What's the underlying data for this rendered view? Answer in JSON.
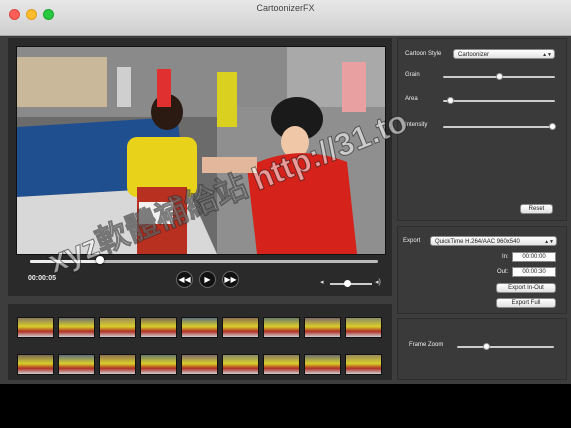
{
  "window": {
    "title": "CartoonizerFX"
  },
  "player": {
    "time": "00:00:05",
    "scrub_fraction": 0.2,
    "volume_fraction": 0.4
  },
  "controls": {
    "cartoon_style_label": "Cartoon Style",
    "cartoon_style_value": "Cartoonizer",
    "grain_label": "Grain",
    "grain_value": 0.5,
    "area_label": "Area",
    "area_value": 0.06,
    "intensity_label": "Intensity",
    "intensity_value": 0.97,
    "reset_label": "Reset"
  },
  "export": {
    "label": "Export",
    "format_value": "QuickTime H.264/AAC 960x540",
    "in_label": "In:",
    "in_value": "00:00:00",
    "out_label": "Out:",
    "out_value": "00:00:30",
    "export_inout_label": "Export In-Out",
    "export_full_label": "Export Full"
  },
  "zoom": {
    "label": "Frame Zoom",
    "value": 0.3
  },
  "watermark_text": "xyz軟體補給站 http://31.to",
  "colors": {
    "panel": "#3a3a3a",
    "video_bg": "#2a2a2a",
    "accent_red": "#fc5f57"
  }
}
